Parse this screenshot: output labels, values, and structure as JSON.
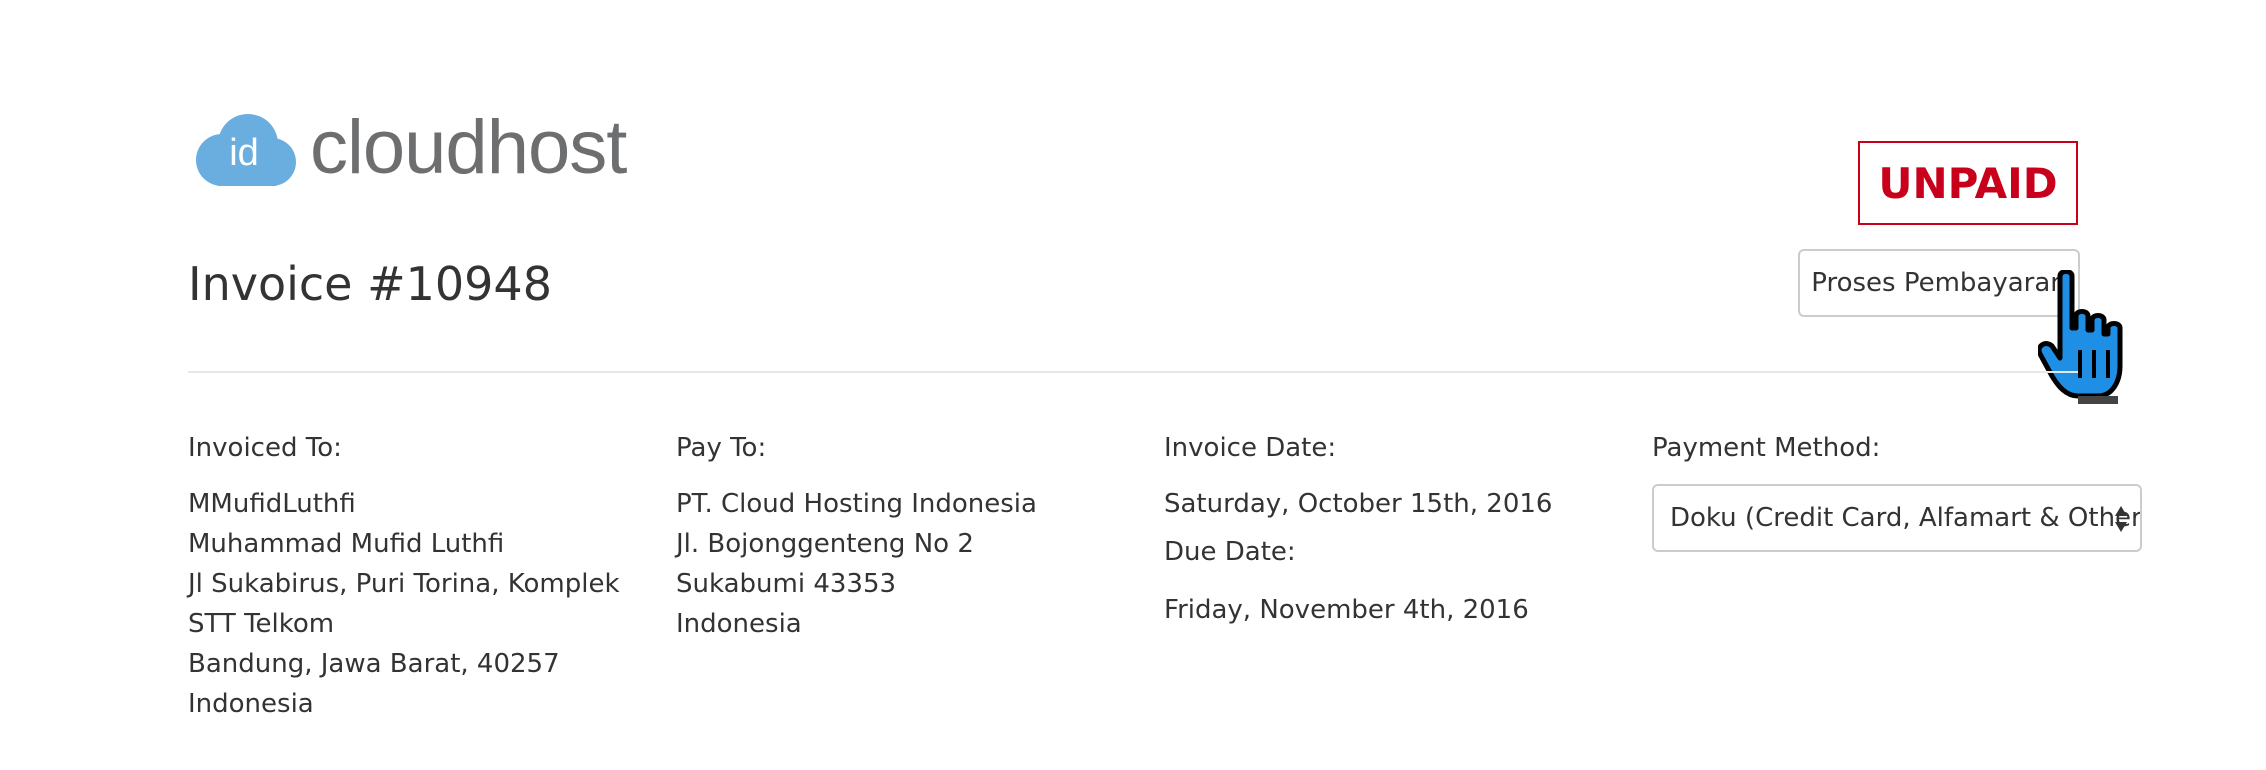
{
  "brand": {
    "logo_id_text": "id",
    "logo_word": "cloudhost",
    "logo_color": "#6aaee0"
  },
  "invoice": {
    "title": "Invoice #10948",
    "status": "UNPAID",
    "status_color": "#c9001b",
    "pay_button_label": "Proses Pembayaran"
  },
  "invoiced_to": {
    "label": "Invoiced To:",
    "lines": [
      "MMufidLuthfi",
      "Muhammad Mufid Luthfi",
      "Jl Sukabirus, Puri Torina, Komplek",
      "STT Telkom",
      "Bandung, Jawa Barat, 40257",
      "Indonesia"
    ]
  },
  "pay_to": {
    "label": "Pay To:",
    "lines": [
      "PT. Cloud Hosting Indonesia",
      "Jl. Bojonggenteng No 2",
      "Sukabumi 43353",
      "Indonesia"
    ]
  },
  "dates": {
    "invoice_date_label": "Invoice Date:",
    "invoice_date": "Saturday, October 15th, 2016",
    "due_date_label": "Due Date:",
    "due_date": "Friday, November 4th, 2016"
  },
  "payment": {
    "label": "Payment Method:",
    "selected": "Doku (Credit Card, Alfamart & Others)"
  },
  "icons": {
    "cursor": "hand-pointer-icon",
    "select_arrows": "select-updown-icon"
  }
}
